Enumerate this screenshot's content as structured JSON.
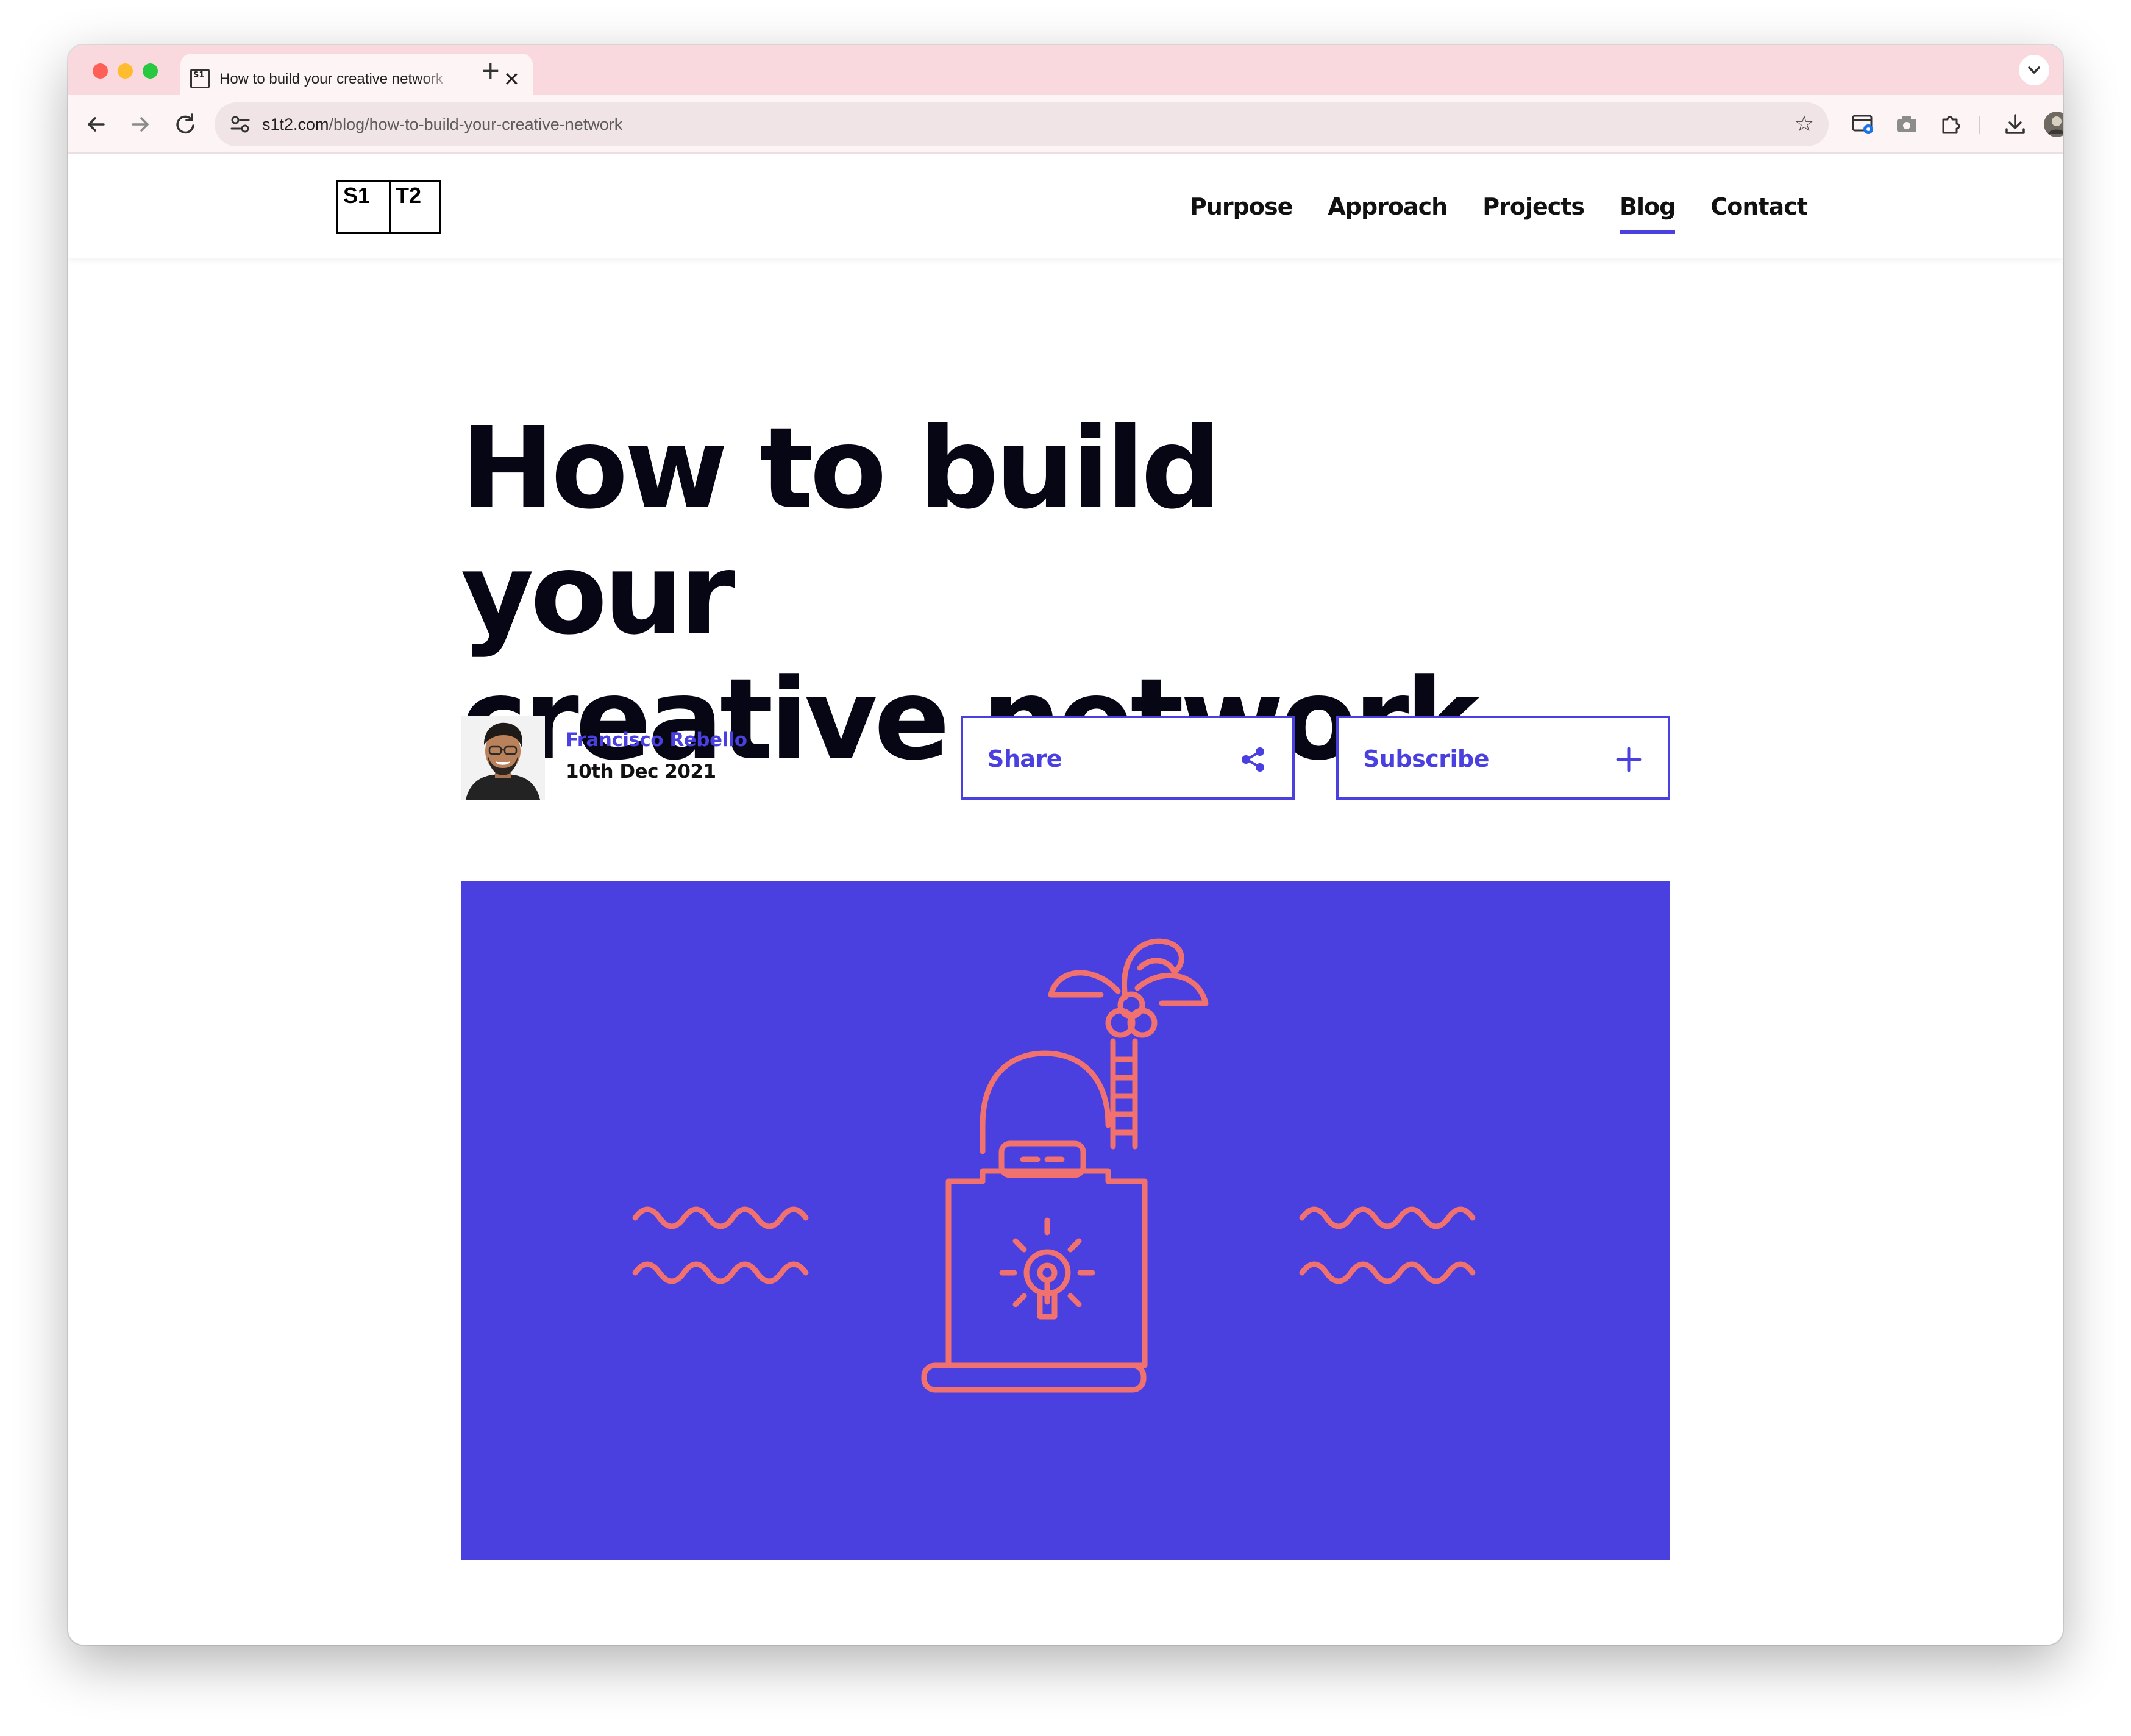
{
  "browser": {
    "tab_title": "How to build your creative network",
    "tab_favicon_text": "S1",
    "tab_close_glyph": "✕",
    "tab_new_glyph": "+",
    "tab_dropdown_glyph": "⌄",
    "url_host": "s1t2.com",
    "url_path": "/blog/how-to-build-your-creative-network",
    "back_glyph": "←",
    "forward_glyph": "→",
    "reload_glyph": "↻",
    "star_glyph": "☆",
    "tab_strip_color": "#f9d9de",
    "toolbar_color": "#fdf4f5"
  },
  "site": {
    "logo_left": "S1",
    "logo_right": "T2",
    "nav": [
      {
        "label": "Purpose"
      },
      {
        "label": "Approach"
      },
      {
        "label": "Projects"
      },
      {
        "label": "Blog",
        "active": true
      },
      {
        "label": "Contact"
      }
    ],
    "accent_color": "#4a3fdf"
  },
  "article": {
    "title_line1": "How to build your",
    "title_line2": "creative network",
    "author_name": "Francisco Rebello",
    "date": "10th Dec 2021",
    "share_label": "Share",
    "subscribe_label": "Subscribe",
    "hero_background": "#4a3fdf",
    "hero_line_color": "#f0716e",
    "hero_icon": "laptop-lightbulb-palm-illustration"
  }
}
